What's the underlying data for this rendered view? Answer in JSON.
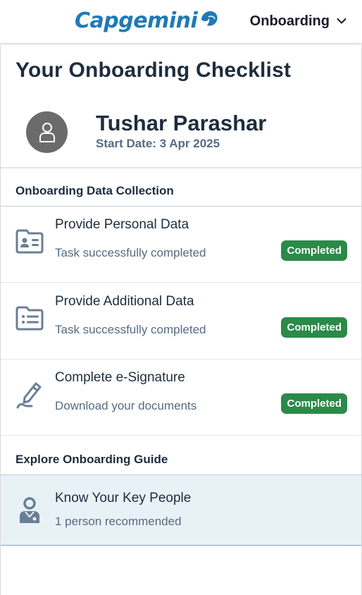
{
  "header": {
    "logo_text": "Capgemini",
    "menu_label": "Onboarding",
    "brand_color": "#1e7ab6"
  },
  "page": {
    "title": "Your Onboarding Checklist"
  },
  "profile": {
    "name": "Tushar Parashar",
    "start_date": "Start Date: 3 Apr 2025",
    "avatar_icon": "person-icon"
  },
  "sections": {
    "data_collection": {
      "title": "Onboarding Data Collection",
      "tasks": [
        {
          "title": "Provide Personal Data",
          "subtitle": "Task successfully completed",
          "status": "Completed",
          "icon": "id-card-icon"
        },
        {
          "title": "Provide Additional Data",
          "subtitle": "Task successfully completed",
          "status": "Completed",
          "icon": "folder-list-icon"
        },
        {
          "title": "Complete e-Signature",
          "subtitle": "Download your documents",
          "status": "Completed",
          "icon": "signature-pen-icon"
        }
      ]
    },
    "guide": {
      "title": "Explore Onboarding Guide",
      "items": [
        {
          "title": "Know Your Key People",
          "subtitle": "1 person recommended",
          "icon": "key-person-icon"
        }
      ]
    }
  },
  "colors": {
    "completed_badge": "#2b8a48",
    "icon_gray": "#6a7e96",
    "selected_row_bg": "#e8f1f6"
  }
}
